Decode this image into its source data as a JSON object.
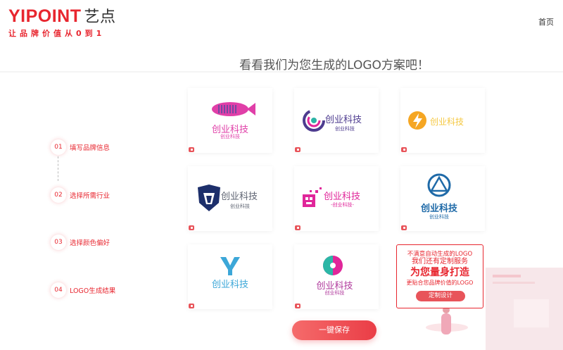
{
  "header": {
    "brand_name": "YIPOINT",
    "brand_cn": "艺点",
    "slogan": "让品牌价值从0到1",
    "home_link": "首页"
  },
  "page_title": "看看我们为您生成的LOGO方案吧！",
  "steps": [
    {
      "num": "01",
      "label": "填写品牌信息"
    },
    {
      "num": "02",
      "label": "选择所需行业"
    },
    {
      "num": "03",
      "label": "选择颜色偏好"
    },
    {
      "num": "04",
      "label": "LOGO生成结果"
    }
  ],
  "logos": [
    {
      "title": "创业科技",
      "subtitle": "创业科技",
      "color": "#e03fa8"
    },
    {
      "title": "创业科技",
      "subtitle": "创业科技",
      "color": "#4d3b8f"
    },
    {
      "title": "创业科技",
      "subtitle": "",
      "color": "#f5a623"
    },
    {
      "title": "创业科技",
      "subtitle": "创业科技",
      "color": "#5e6472"
    },
    {
      "title": "创业科技",
      "subtitle": "-创业科技-",
      "color": "#e0269a"
    },
    {
      "title": "创业科技",
      "subtitle": "创业科技",
      "color": "#1f6aa8"
    },
    {
      "title": "创业科技",
      "subtitle": "",
      "color": "#3ca7d8"
    },
    {
      "title": "创业科技",
      "subtitle": "创业科技",
      "color": "#b03a9c"
    }
  ],
  "promo": {
    "line1": "不满意自动生成的LOGO",
    "line2": "我们还有定制服务",
    "line3": "为您量身打造",
    "line4": "更贴合您品牌价值的LOGO",
    "button": "定制设计"
  },
  "save_button": "一键保存",
  "colors": {
    "accent": "#e8262f",
    "button": "#ea3d46"
  }
}
